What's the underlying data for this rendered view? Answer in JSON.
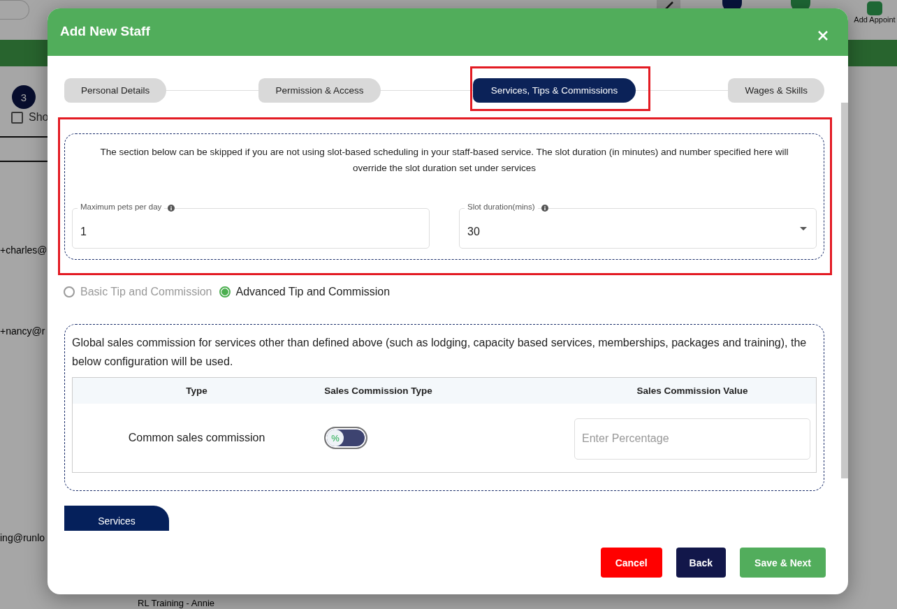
{
  "background": {
    "step_badge": "3",
    "checkbox": {
      "label": "Sho",
      "checked": false
    },
    "top_action": "Add Appoint",
    "emails": [
      "+charles@",
      "+nancy@r",
      "ing@runlo"
    ],
    "list_item": "RL Training - Annie"
  },
  "dialog": {
    "title": "Add New Staff",
    "tabs": [
      {
        "label": "Personal Details",
        "selected": false
      },
      {
        "label": "Permission & Access",
        "selected": false
      },
      {
        "label": "Services, Tips & Commissions",
        "selected": true
      },
      {
        "label": "Wages & Skills",
        "selected": false
      }
    ],
    "slot_section": {
      "note": "The section below can be skipped if you are not using slot-based scheduling in your staff-based service. The slot duration (in minutes) and number specified here will override the slot duration set under services",
      "fields": [
        {
          "kind": "text",
          "label": "Maximum pets per day",
          "value": "1"
        },
        {
          "kind": "select",
          "label": "Slot duration(mins)",
          "value": "30"
        }
      ]
    },
    "tip_modes": [
      {
        "label": "Basic Tip and Commission",
        "selected": false
      },
      {
        "label": "Advanced Tip and Commission",
        "selected": true
      }
    ],
    "global_section": {
      "note": "Global sales commission for services other than defined above (such as lodging, capacity based services, memberships, packages and training), the below configuration will be used.",
      "table": {
        "columns": [
          "Type",
          "Sales Commission Type",
          "Sales Commission Value"
        ],
        "rows": [
          {
            "type": "Common sales commission",
            "toggle": {
              "label": "%",
              "on": false
            },
            "value_placeholder": "Enter Percentage"
          }
        ]
      }
    },
    "section_tab": "Services",
    "buttons": [
      {
        "kind": "cancel",
        "label": "Cancel"
      },
      {
        "kind": "back",
        "label": "Back"
      },
      {
        "kind": "save",
        "label": "Save & Next"
      }
    ]
  }
}
